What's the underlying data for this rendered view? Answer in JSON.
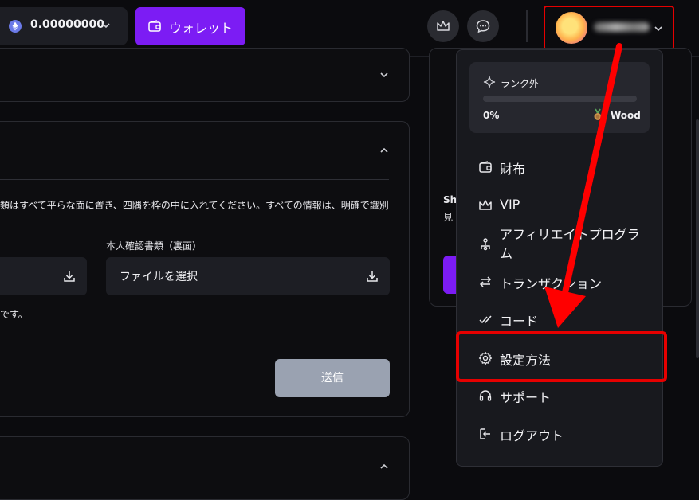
{
  "header": {
    "balance": "0.00000000",
    "wallet_button": "ウォレット"
  },
  "main": {
    "instructions": "類はすべて平らな面に置き、四隅を枠の中に入れてください。すべての情報は、明確で識別",
    "back_label": "本人確認書類（裏面）",
    "file_placeholder": "ファイルを選択",
    "note": "です。",
    "submit": "送信"
  },
  "right_panel": {
    "text1": "Sh",
    "text2": "見"
  },
  "menu": {
    "rank": {
      "title": "ランク外",
      "percent": "0%",
      "progress": 0,
      "tier": "Wood"
    },
    "items": [
      {
        "label": "財布",
        "icon": "wallet-icon"
      },
      {
        "label": "VIP",
        "icon": "crown-icon"
      },
      {
        "label": "アフィリエイトプログラム",
        "icon": "affiliate-icon"
      },
      {
        "label": "トランザクション",
        "icon": "swap-icon"
      },
      {
        "label": "コード",
        "icon": "check-double-icon"
      },
      {
        "label": "設定方法",
        "icon": "gear-icon"
      },
      {
        "label": "サポート",
        "icon": "headset-icon"
      },
      {
        "label": "ログアウト",
        "icon": "logout-icon"
      }
    ]
  },
  "colors": {
    "accent": "#7c1cf4",
    "highlight": "#e60000",
    "background": "#0b0b0e"
  }
}
